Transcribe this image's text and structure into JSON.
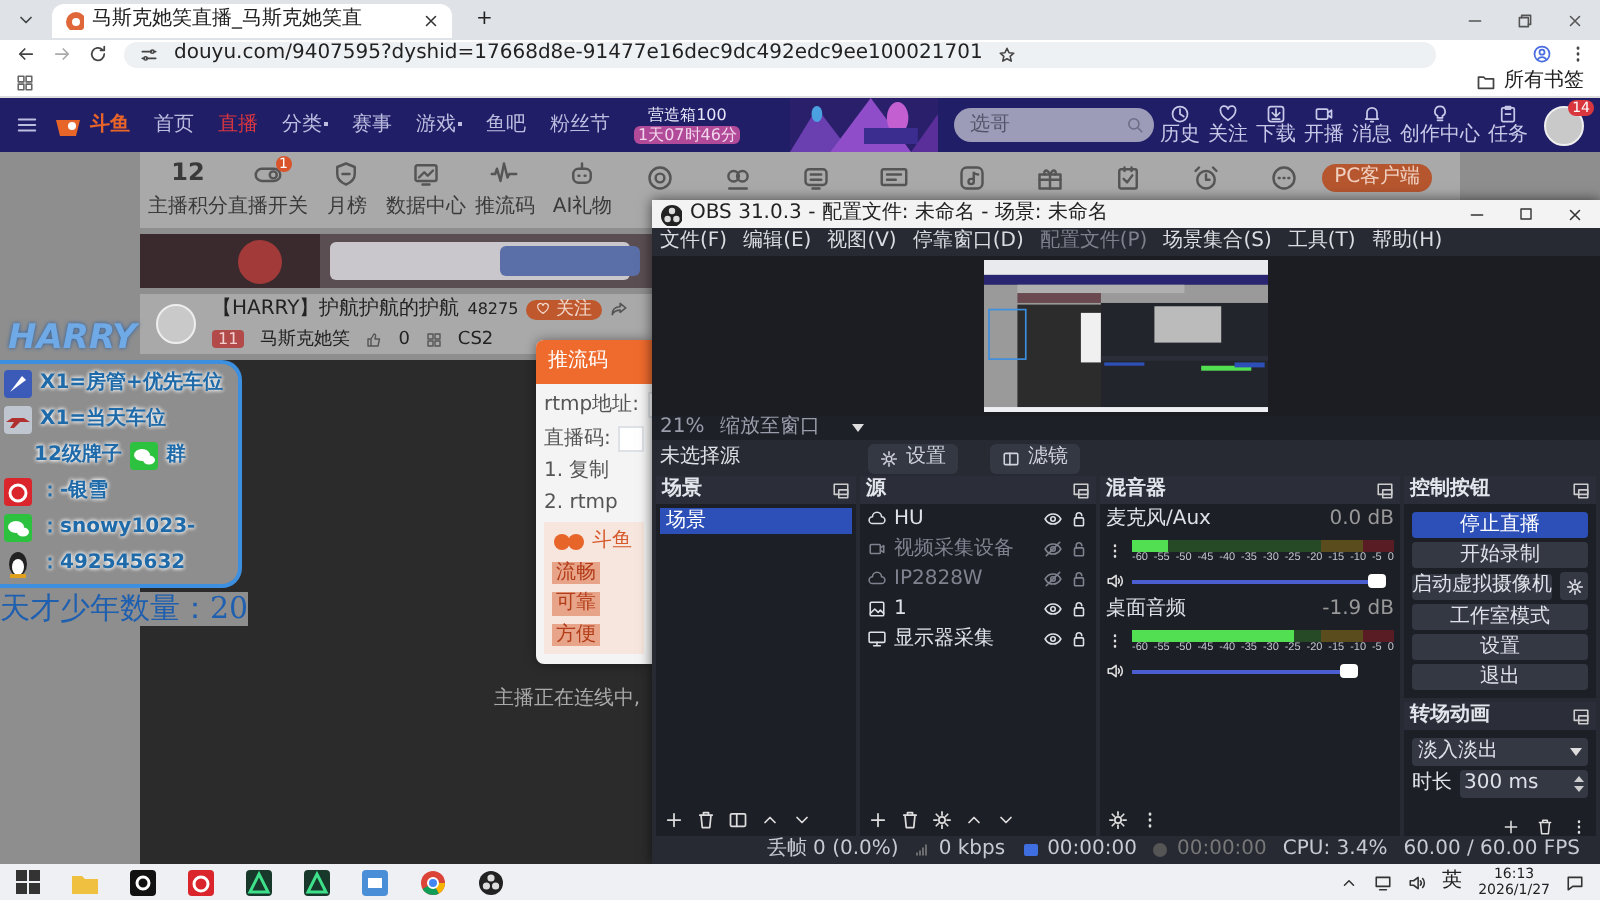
{
  "browser": {
    "tab_title": "马斯克她笑直播_马斯克她笑直",
    "new_tab": "+",
    "url": "douyu.com/9407595?dyshid=17668d8e-91477e16dec9dc492edc9ee100021701",
    "bookmarks_label": "所有书签"
  },
  "site_nav": {
    "logo": "斗鱼",
    "links": [
      {
        "label": "首页",
        "selected": false,
        "dropdown": false
      },
      {
        "label": "直播",
        "selected": true,
        "dropdown": false
      },
      {
        "label": "分类",
        "selected": false,
        "dropdown": true
      },
      {
        "label": "赛事",
        "selected": false,
        "dropdown": false
      },
      {
        "label": "游戏",
        "selected": false,
        "dropdown": true
      },
      {
        "label": "鱼吧",
        "selected": false,
        "dropdown": false
      },
      {
        "label": "粉丝节",
        "selected": false,
        "dropdown": false
      }
    ],
    "promo": {
      "title": "营造箱100",
      "timer": "1天07时46分"
    },
    "search": {
      "placeholder": "选哥"
    },
    "actions": [
      "历史",
      "关注",
      "下载",
      "开播",
      "消息",
      "创作中心",
      "任务"
    ],
    "avatar_badge": "14"
  },
  "toolbar": {
    "score": "12",
    "items": [
      {
        "label": "主播积分"
      },
      {
        "label": "直播开关",
        "badge": "1"
      },
      {
        "label": "月榜"
      },
      {
        "label": "数据中心"
      },
      {
        "label": "推流码"
      },
      {
        "label": "AI礼物"
      }
    ],
    "client_button": "PC客户端"
  },
  "streamer": {
    "name": "【HARRY】护航护航的护航",
    "followers": "48275",
    "follow": "关注",
    "level": "11",
    "owner": "马斯克她笑",
    "likes": "0",
    "game": "CS2"
  },
  "overlay": {
    "logo": "HARRY",
    "lines": [
      {
        "kind": "icon",
        "text": "X1=房管+优先车位"
      },
      {
        "kind": "icon",
        "text": "X1=当天车位"
      },
      {
        "kind": "group",
        "text": "12级牌子",
        "suffix": "群"
      },
      {
        "kind": "icon",
        "text": "：-银雪"
      },
      {
        "kind": "icon",
        "text": "：snowy1023-"
      },
      {
        "kind": "icon",
        "text": "：492545632"
      }
    ],
    "counter": "天才少年数量：20"
  },
  "popup": {
    "title": "推流码",
    "fields": [
      "rtmp地址:",
      "直播码:"
    ],
    "steps": [
      "1. 复制",
      "2. rtmp"
    ],
    "brand": "斗鱼",
    "tags": [
      "流畅",
      "可靠",
      "方便"
    ]
  },
  "video_status": "主播正在连线中,",
  "obs": {
    "title": "OBS 31.0.3 - 配置文件: 未命名 - 场景: 未命名",
    "menu": [
      {
        "label": "文件(F)",
        "disabled": false
      },
      {
        "label": "编辑(E)",
        "disabled": false
      },
      {
        "label": "视图(V)",
        "disabled": false
      },
      {
        "label": "停靠窗口(D)",
        "disabled": false
      },
      {
        "label": "配置文件(P)",
        "disabled": true
      },
      {
        "label": "场景集合(S)",
        "disabled": false
      },
      {
        "label": "工具(T)",
        "disabled": false
      },
      {
        "label": "帮助(H)",
        "disabled": false
      }
    ],
    "zoom": "21%",
    "scale_mode": "缩放至窗口",
    "source_bar": {
      "label": "未选择源",
      "buttons": [
        "设置",
        "滤镜"
      ]
    },
    "scenes": {
      "title": "场景",
      "items": [
        {
          "label": "场景",
          "selected": true
        }
      ]
    },
    "sources": {
      "title": "源",
      "items": [
        {
          "label": "HU",
          "visible": true
        },
        {
          "label": "视频采集设备",
          "visible": false
        },
        {
          "label": "IP2828W",
          "visible": false
        },
        {
          "label": "1",
          "visible": true
        },
        {
          "label": "显示器采集",
          "visible": true
        }
      ]
    },
    "mixer": {
      "title": "混音器",
      "channels": [
        {
          "name": "麦克风/Aux",
          "reading": "0.0 dB",
          "meter": {
            "level": 0.14
          },
          "fader": {
            "level": 0.97
          },
          "scale": [
            "-60",
            "-55",
            "-50",
            "-45",
            "-40",
            "-35",
            "-30",
            "-25",
            "-20",
            "-15",
            "-10",
            "-5",
            "0"
          ]
        },
        {
          "name": "桌面音频",
          "reading": "-1.9 dB",
          "meter": {
            "level": 0.62
          },
          "fader": {
            "level": 0.86
          },
          "scale": [
            "-60",
            "-55",
            "-50",
            "-45",
            "-40",
            "-35",
            "-30",
            "-25",
            "-20",
            "-15",
            "-10",
            "-5",
            "0"
          ]
        }
      ]
    },
    "controls": {
      "title": "控制按钮",
      "buttons": [
        {
          "label": "停止直播",
          "primary": true,
          "gear": false
        },
        {
          "label": "开始录制",
          "primary": false,
          "gear": false
        },
        {
          "label": "启动虚拟摄像机",
          "primary": false,
          "gear": true
        },
        {
          "label": "工作室模式",
          "primary": false,
          "gear": false
        },
        {
          "label": "设置",
          "primary": false,
          "gear": false
        },
        {
          "label": "退出",
          "primary": false,
          "gear": false
        }
      ]
    },
    "transitions": {
      "title": "转场动画",
      "selected": "淡入淡出",
      "duration_label": "时长",
      "duration": "300 ms"
    },
    "status": [
      "丢帧 0 (0.0%)",
      "0 kbps",
      "00:00:00",
      "00:00:00",
      "CPU: 3.4%",
      "60.00 / 60.00 FPS"
    ]
  },
  "taskbar": {
    "ime": "英",
    "time": "16:13",
    "date": "2026/1/27"
  }
}
